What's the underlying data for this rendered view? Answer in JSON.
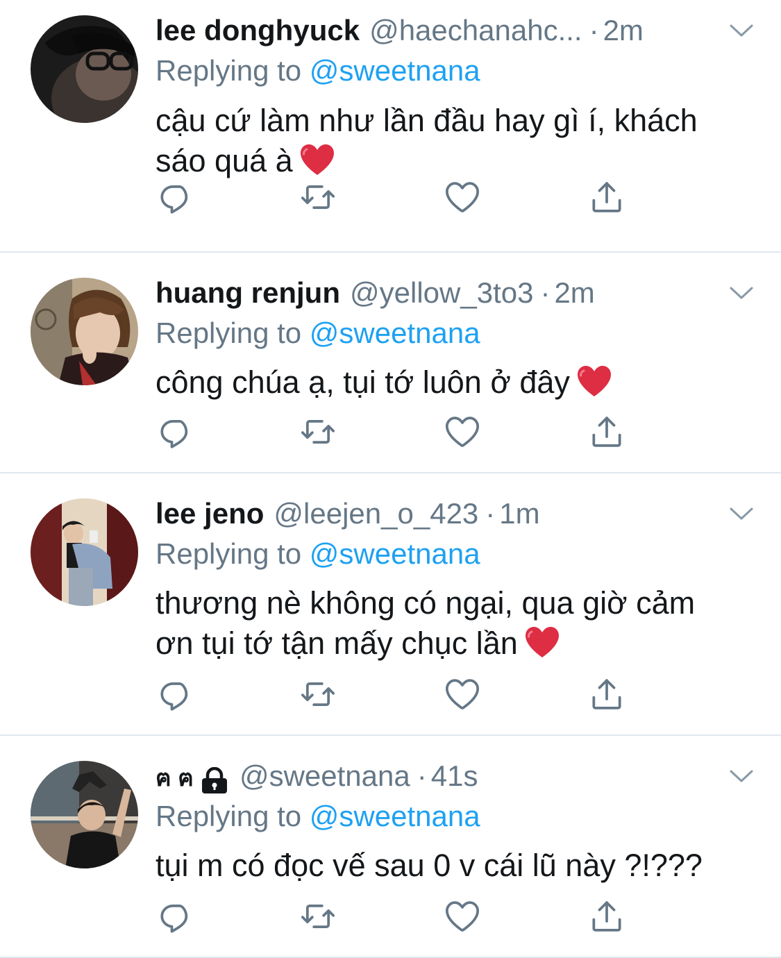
{
  "colors": {
    "text": "#14171a",
    "secondary": "#657786",
    "link": "#1da1f2",
    "divider": "#e1e8ed",
    "heart": "#e0245e"
  },
  "icons": {
    "reply": "reply-icon",
    "retweet": "retweet-icon",
    "like": "like-icon",
    "share": "share-icon",
    "caret": "chevron-down-icon"
  },
  "tweets": [
    {
      "name": "lee donghyuck",
      "handle": "@haechanahc...",
      "dot": "·",
      "time": "2m",
      "replying_prefix": "Replying to",
      "replying_to": "@sweetnana",
      "text": "cậu cứ làm như lần đầu hay gì í, khách sáo quá à",
      "emoji": "❤️"
    },
    {
      "name": "huang renjun",
      "handle": "@yellow_3to3",
      "dot": "·",
      "time": "2m",
      "replying_prefix": "Replying to",
      "replying_to": "@sweetnana",
      "text": "công chúa ạ, tụi tớ luôn ở đây",
      "emoji": "❤️"
    },
    {
      "name": "lee jeno",
      "handle": "@leejen_o_423",
      "dot": "·",
      "time": "1m",
      "replying_prefix": "Replying to",
      "replying_to": "@sweetnana",
      "text": "thương nè không có ngại, qua giờ cảm ơn tụi tớ tận mấy chục lần",
      "emoji": "❤️"
    },
    {
      "name": "ฅ ฅ",
      "handle": "@sweetnana",
      "dot": "·",
      "time": "41s",
      "replying_prefix": "Replying to",
      "replying_to": "@sweetnana",
      "text": "tụi m có đọc vế sau 0 v cái lũ này ?!???",
      "emoji": ""
    }
  ]
}
